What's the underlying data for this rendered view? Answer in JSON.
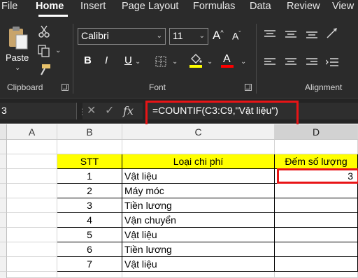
{
  "tabs": [
    "File",
    "Home",
    "Insert",
    "Page Layout",
    "Formulas",
    "Data",
    "Review",
    "View"
  ],
  "active_tab": "Home",
  "ribbon": {
    "clipboard": {
      "paste_label": "Paste",
      "group_label": "Clipboard"
    },
    "font": {
      "font_name": "Calibri",
      "font_size": "11",
      "bold": "B",
      "italic": "I",
      "underline": "U",
      "grow": "A",
      "shrink": "A",
      "font_color_letter": "A",
      "group_label": "Font",
      "highlight_color": "#ffff00",
      "font_color": "#ff0000"
    },
    "alignment": {
      "group_label": "Alignment"
    }
  },
  "formula_bar": {
    "name_box": "3",
    "cancel": "✕",
    "enter": "✓",
    "fx": "fx",
    "formula": "=COUNTIF(C3:C9,\"Vật liệu\")"
  },
  "columns": [
    "A",
    "B",
    "C",
    "D"
  ],
  "selected_column": "D",
  "table": {
    "headers": [
      "STT",
      "Loại chi phí",
      "Đếm số lượng"
    ],
    "rows": [
      {
        "stt": "1",
        "loai": "Vật liệu",
        "dem": "3"
      },
      {
        "stt": "2",
        "loai": "Máy móc",
        "dem": ""
      },
      {
        "stt": "3",
        "loai": "Tiền lương",
        "dem": ""
      },
      {
        "stt": "4",
        "loai": "Vận chuyển",
        "dem": ""
      },
      {
        "stt": "5",
        "loai": "Vật liệu",
        "dem": ""
      },
      {
        "stt": "6",
        "loai": "Tiền lương",
        "dem": ""
      },
      {
        "stt": "7",
        "loai": "Vật liệu",
        "dem": ""
      }
    ]
  },
  "colors": {
    "header_fill": "#ffff00",
    "highlight_border": "#e81416",
    "ribbon_bg": "#2b2b2b"
  }
}
